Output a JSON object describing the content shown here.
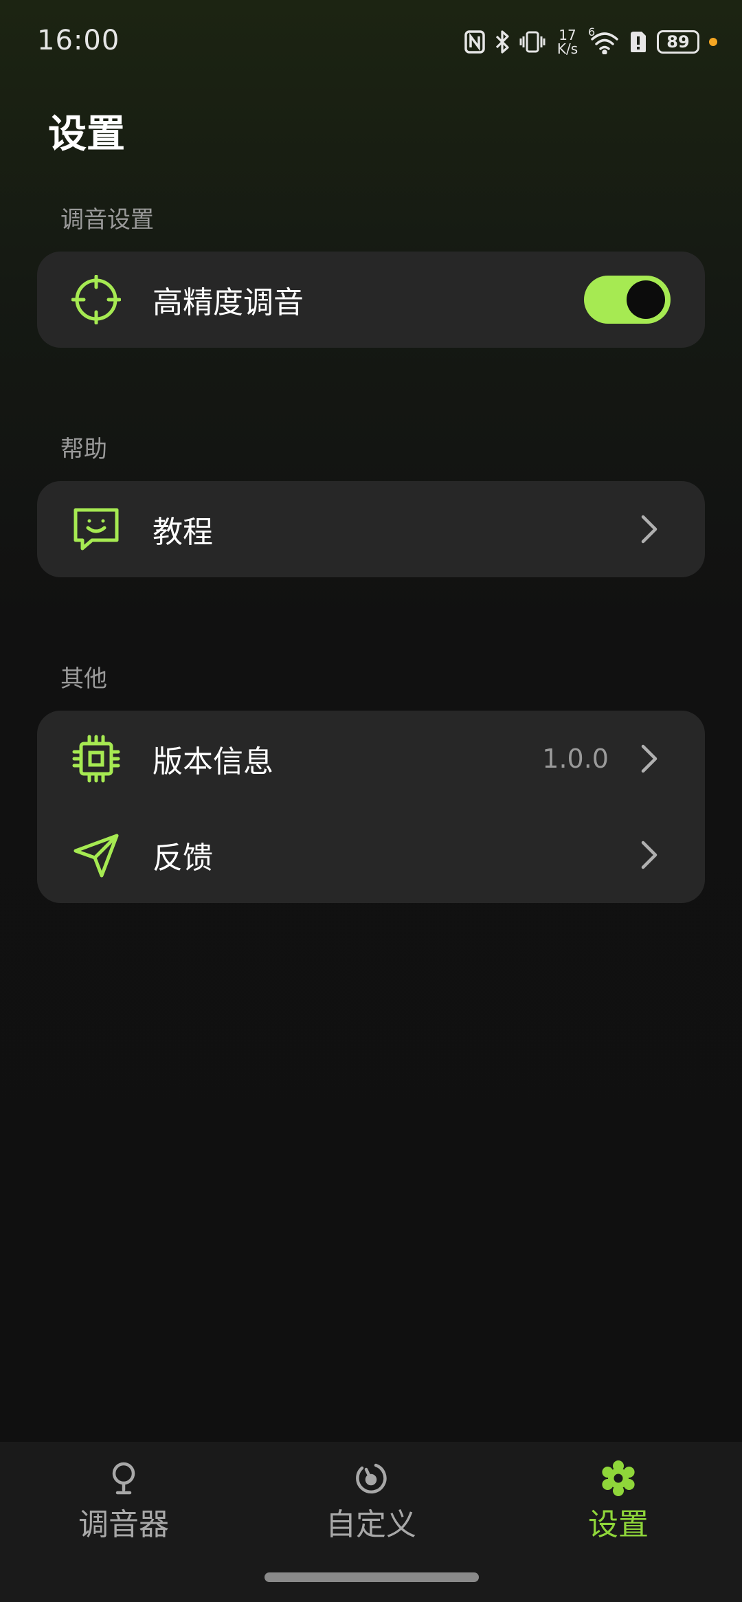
{
  "status_bar": {
    "time": "16:00",
    "net_speed_value": "17",
    "net_speed_unit": "K/s",
    "wifi_label": "6",
    "battery_level": "89",
    "icons": [
      "nfc-icon",
      "bluetooth-icon",
      "vibrate-icon",
      "wifi-icon",
      "sim-alert-icon",
      "battery-icon"
    ]
  },
  "page": {
    "title": "设置"
  },
  "sections": {
    "tuning": {
      "label": "调音设置",
      "rows": [
        {
          "label": "高精度调音",
          "icon": "crosshair-icon",
          "toggle_on": true
        }
      ]
    },
    "help": {
      "label": "帮助",
      "rows": [
        {
          "label": "教程",
          "icon": "smile-chat-icon"
        }
      ]
    },
    "other": {
      "label": "其他",
      "rows": [
        {
          "label": "版本信息",
          "value": "1.0.0",
          "icon": "chip-icon"
        },
        {
          "label": "反馈",
          "icon": "send-icon"
        }
      ]
    }
  },
  "bottom_nav": {
    "items": [
      {
        "label": "调音器",
        "icon": "tuner-icon",
        "active": false
      },
      {
        "label": "自定义",
        "icon": "custom-icon",
        "active": false
      },
      {
        "label": "设置",
        "icon": "settings-gear-icon",
        "active": true
      }
    ]
  },
  "colors": {
    "accent": "#a6ea52",
    "accent_text": "#8fd63a",
    "card": "#272727",
    "muted_text": "#9a9a9a",
    "battery_dot": "#f5a623"
  }
}
